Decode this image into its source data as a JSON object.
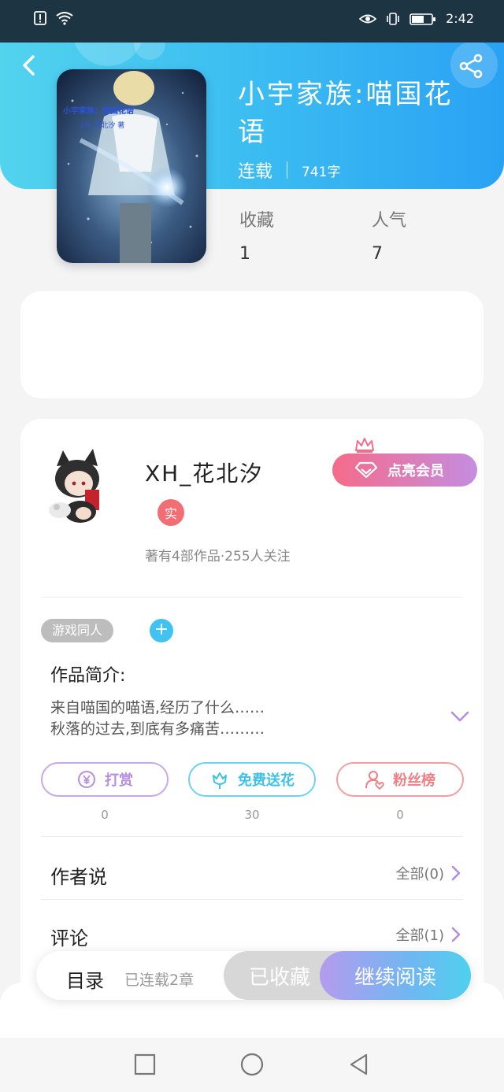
{
  "status_bar": {
    "time": "2:42"
  },
  "book": {
    "title": "小宇家族:喵国花语",
    "status": "连载",
    "word_count": "741字",
    "stats": [
      {
        "label": "收藏",
        "value": "1"
      },
      {
        "label": "人气",
        "value": "7"
      }
    ],
    "cover_text": {
      "line1": "小宇家族：喵国花语",
      "line2": "XH_花北汐 著"
    }
  },
  "author": {
    "name": "XH_花北汐",
    "badge": "实",
    "description": "著有4部作品·255人关注",
    "vip_button": "点亮会员"
  },
  "tags": [
    "游戏同人"
  ],
  "tag_add_label": "+",
  "intro": {
    "title": "作品简介:",
    "lines": [
      "来自喵国的喵语,经历了什么……",
      "秋落的过去,到底有多痛苦………"
    ]
  },
  "actions": [
    {
      "label": "打赏",
      "count": "0",
      "color": "#b58ee0"
    },
    {
      "label": "免费送花",
      "count": "30",
      "color": "#4cc7ea"
    },
    {
      "label": "粉丝榜",
      "count": "0",
      "color": "#ee7f84"
    }
  ],
  "rows": [
    {
      "label": "作者说",
      "value": "全部(0)"
    },
    {
      "label": "评论",
      "value": "全部(1)"
    }
  ],
  "bottom_bar": {
    "catalog_label": "目录",
    "catalog_count": "已连载2章",
    "collected_label": "已收藏",
    "read_label": "继续阅读"
  },
  "colors": {
    "header_start": "#52d3ee",
    "header_end": "#2aa2f4",
    "status_bar": "#1d3443"
  }
}
